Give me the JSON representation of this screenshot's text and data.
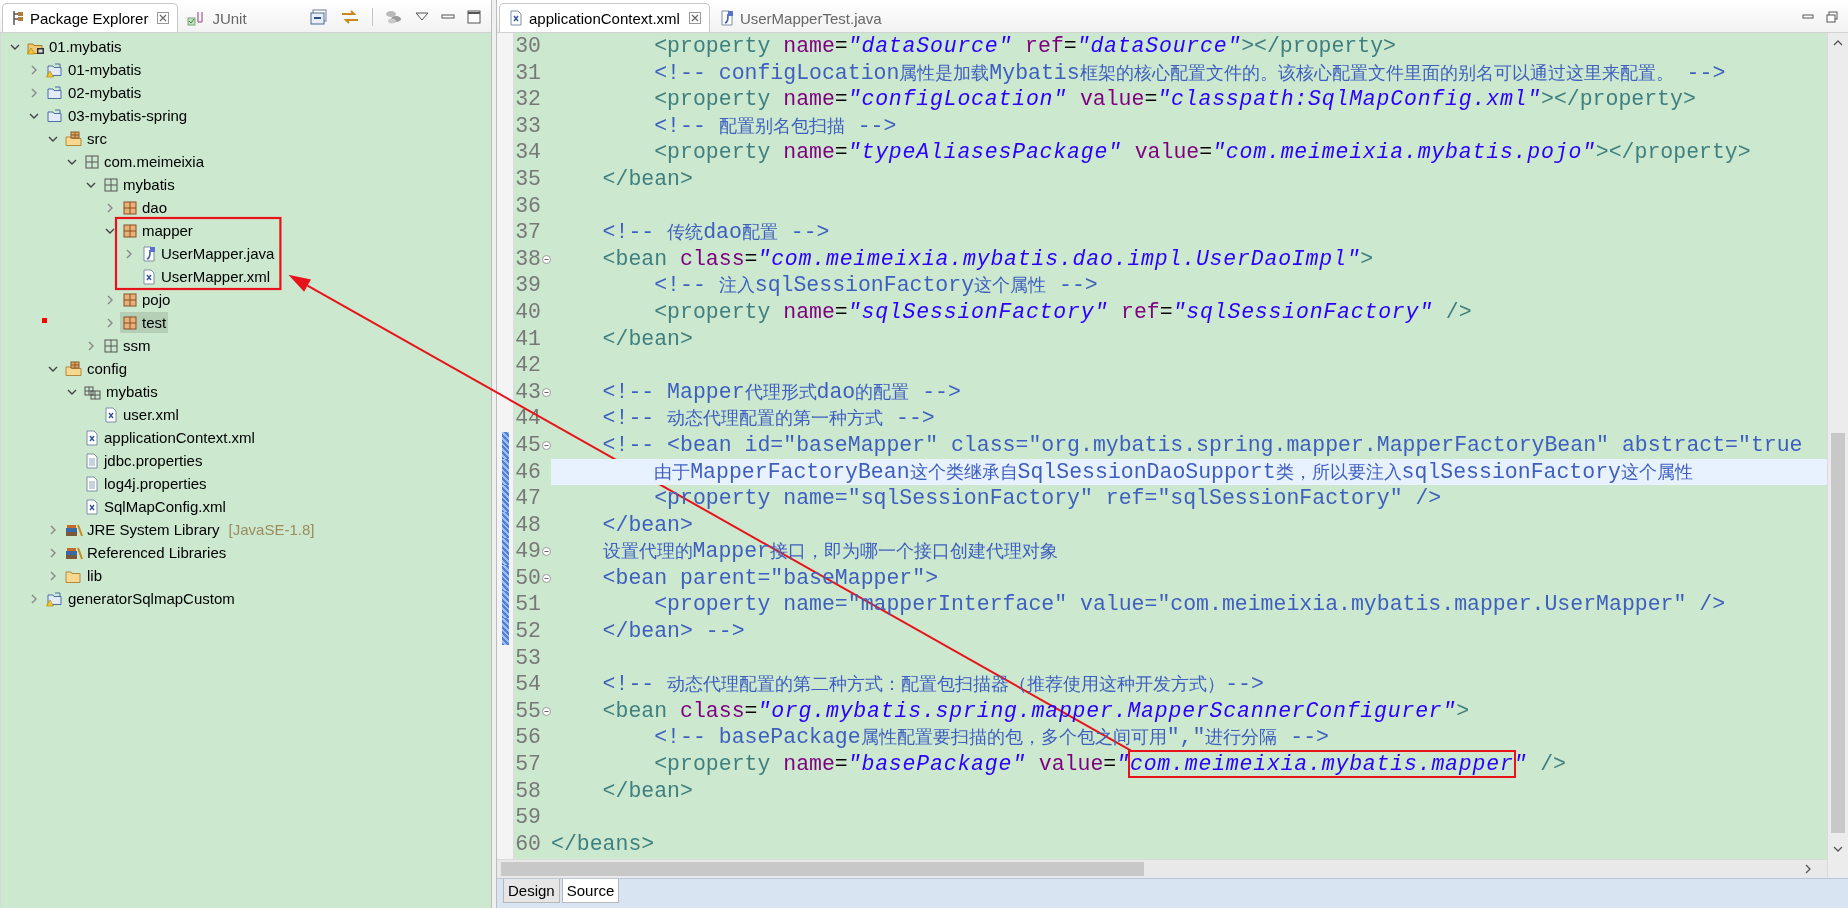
{
  "explorer": {
    "tabs": [
      {
        "label": "Package Explorer",
        "kind": "explorer",
        "selected": true
      },
      {
        "label": "JUnit",
        "kind": "junit",
        "selected": false
      }
    ],
    "tree": [
      {
        "label": "01.mybatis",
        "kind": "working-set",
        "expanded": true,
        "selected": false,
        "boxed": false,
        "children": [
          {
            "label": "01-mybatis",
            "kind": "project-warning",
            "expanded": false,
            "selected": false,
            "boxed": false
          },
          {
            "label": "02-mybatis",
            "kind": "project",
            "expanded": false,
            "selected": false,
            "boxed": false
          },
          {
            "label": "03-mybatis-spring",
            "kind": "project",
            "expanded": true,
            "selected": false,
            "boxed": false,
            "children": [
              {
                "label": "src",
                "kind": "source-folder",
                "expanded": true,
                "selected": false,
                "boxed": false,
                "children": [
                  {
                    "label": "com.meimeixia",
                    "kind": "package-empty",
                    "expanded": true,
                    "selected": false,
                    "boxed": false,
                    "children": [
                      {
                        "label": "mybatis",
                        "kind": "package-empty",
                        "expanded": true,
                        "selected": false,
                        "boxed": false,
                        "children": [
                          {
                            "label": "dao",
                            "kind": "package",
                            "expanded": false,
                            "selected": false,
                            "boxed": false
                          },
                          {
                            "label": "mapper",
                            "kind": "package",
                            "expanded": true,
                            "selected": false,
                            "boxed": true,
                            "children": [
                              {
                                "label": "UserMapper.java",
                                "kind": "java-file",
                                "expanded": false,
                                "selected": false,
                                "boxed": true
                              },
                              {
                                "label": "UserMapper.xml",
                                "kind": "xml-file",
                                "selected": false,
                                "boxed": true
                              }
                            ]
                          },
                          {
                            "label": "pojo",
                            "kind": "package",
                            "expanded": false,
                            "selected": false,
                            "boxed": false
                          },
                          {
                            "label": "test",
                            "kind": "package",
                            "expanded": false,
                            "selected": true,
                            "boxed": false
                          }
                        ]
                      },
                      {
                        "label": "ssm",
                        "kind": "package-empty",
                        "expanded": false,
                        "selected": false,
                        "boxed": false
                      }
                    ]
                  }
                ]
              },
              {
                "label": "config",
                "kind": "source-folder",
                "expanded": true,
                "selected": false,
                "boxed": false,
                "children": [
                  {
                    "label": "mybatis",
                    "kind": "package-hier",
                    "expanded": true,
                    "selected": false,
                    "boxed": false,
                    "children": [
                      {
                        "label": "user.xml",
                        "kind": "xml-file",
                        "selected": false,
                        "boxed": false
                      }
                    ]
                  },
                  {
                    "label": "applicationContext.xml",
                    "kind": "xml-file",
                    "selected": false,
                    "boxed": false
                  },
                  {
                    "label": "jdbc.properties",
                    "kind": "text-file",
                    "selected": false,
                    "boxed": false
                  },
                  {
                    "label": "log4j.properties",
                    "kind": "text-file",
                    "selected": false,
                    "boxed": false
                  },
                  {
                    "label": "SqlMapConfig.xml",
                    "kind": "xml-file",
                    "selected": false,
                    "boxed": false
                  }
                ]
              },
              {
                "label": "JRE System Library",
                "decoration": "[JavaSE-1.8]",
                "kind": "library",
                "expanded": false,
                "selected": false,
                "boxed": false
              },
              {
                "label": "Referenced Libraries",
                "kind": "library",
                "expanded": false,
                "selected": false,
                "boxed": false
              },
              {
                "label": "lib",
                "kind": "folder",
                "expanded": false,
                "selected": false,
                "boxed": false
              }
            ]
          },
          {
            "label": "generatorSqlmapCustom",
            "kind": "project-warning",
            "expanded": false,
            "selected": false,
            "boxed": false
          }
        ]
      }
    ]
  },
  "editor": {
    "tabs": [
      {
        "label": "applicationContext.xml",
        "kind": "xml",
        "selected": true
      },
      {
        "label": "UserMapperTest.java",
        "kind": "java",
        "selected": false
      }
    ],
    "lines": [
      {
        "number": "30",
        "fold": false,
        "changed": false,
        "current": false,
        "segments": [
          {
            "kind": "tag",
            "text": "        <property"
          },
          {
            "kind": "attr",
            "text": " name"
          },
          {
            "kind": "eq",
            "text": "="
          },
          {
            "kind": "value",
            "text": "\"dataSource\""
          },
          {
            "kind": "attr",
            "text": " ref"
          },
          {
            "kind": "eq",
            "text": "="
          },
          {
            "kind": "value",
            "text": "\"dataSource\""
          },
          {
            "kind": "tag",
            "text": "></property>"
          }
        ]
      },
      {
        "number": "31",
        "fold": false,
        "changed": false,
        "current": false,
        "segments": [
          {
            "kind": "comment",
            "text": "        <!-- configLocation属性是加载Mybatis框架的核心配置文件的。该核心配置文件里面的别名可以通过这里来配置。 -->"
          }
        ]
      },
      {
        "number": "32",
        "fold": false,
        "changed": false,
        "current": false,
        "segments": [
          {
            "kind": "tag",
            "text": "        <property"
          },
          {
            "kind": "attr",
            "text": " name"
          },
          {
            "kind": "eq",
            "text": "="
          },
          {
            "kind": "value",
            "text": "\"configLocation\""
          },
          {
            "kind": "attr",
            "text": " value"
          },
          {
            "kind": "eq",
            "text": "="
          },
          {
            "kind": "value",
            "text": "\"classpath:SqlMapConfig.xml\""
          },
          {
            "kind": "tag",
            "text": "></property>"
          }
        ]
      },
      {
        "number": "33",
        "fold": false,
        "changed": false,
        "current": false,
        "segments": [
          {
            "kind": "comment",
            "text": "        <!-- 配置别名包扫描 -->"
          }
        ]
      },
      {
        "number": "34",
        "fold": false,
        "changed": false,
        "current": false,
        "segments": [
          {
            "kind": "tag",
            "text": "        <property"
          },
          {
            "kind": "attr",
            "text": " name"
          },
          {
            "kind": "eq",
            "text": "="
          },
          {
            "kind": "value",
            "text": "\"typeAliasesPackage\""
          },
          {
            "kind": "attr",
            "text": " value"
          },
          {
            "kind": "eq",
            "text": "="
          },
          {
            "kind": "value",
            "text": "\"com.meimeixia.mybatis.pojo\""
          },
          {
            "kind": "tag",
            "text": "></property>"
          }
        ]
      },
      {
        "number": "35",
        "fold": false,
        "changed": false,
        "current": false,
        "segments": [
          {
            "kind": "tag",
            "text": "    </bean>"
          }
        ]
      },
      {
        "number": "36",
        "fold": false,
        "changed": false,
        "current": false
      },
      {
        "number": "37",
        "fold": false,
        "changed": false,
        "current": false,
        "segments": [
          {
            "kind": "comment",
            "text": "    <!-- 传统dao配置 -->"
          }
        ]
      },
      {
        "number": "38",
        "fold": true,
        "changed": false,
        "current": false,
        "segments": [
          {
            "kind": "tag",
            "text": "    <bean"
          },
          {
            "kind": "attr",
            "text": " class"
          },
          {
            "kind": "eq",
            "text": "="
          },
          {
            "kind": "value",
            "text": "\"com.meimeixia.mybatis.dao.impl.UserDaoImpl\""
          },
          {
            "kind": "tag",
            "text": ">"
          }
        ]
      },
      {
        "number": "39",
        "fold": false,
        "changed": false,
        "current": false,
        "segments": [
          {
            "kind": "comment",
            "text": "        <!-- 注入sqlSessionFactory这个属性 -->"
          }
        ]
      },
      {
        "number": "40",
        "fold": false,
        "changed": false,
        "current": false,
        "segments": [
          {
            "kind": "tag",
            "text": "        <property"
          },
          {
            "kind": "attr",
            "text": " name"
          },
          {
            "kind": "eq",
            "text": "="
          },
          {
            "kind": "value",
            "text": "\"sqlSessionFactory\""
          },
          {
            "kind": "attr",
            "text": " ref"
          },
          {
            "kind": "eq",
            "text": "="
          },
          {
            "kind": "value",
            "text": "\"sqlSessionFactory\""
          },
          {
            "kind": "tag",
            "text": " />"
          }
        ]
      },
      {
        "number": "41",
        "fold": false,
        "changed": false,
        "current": false,
        "segments": [
          {
            "kind": "tag",
            "text": "    </bean>"
          }
        ]
      },
      {
        "number": "42",
        "fold": false,
        "changed": false,
        "current": false
      },
      {
        "number": "43",
        "fold": true,
        "changed": false,
        "current": false,
        "segments": [
          {
            "kind": "comment",
            "text": "    <!-- Mapper代理形式dao的配置 -->"
          }
        ]
      },
      {
        "number": "44",
        "fold": false,
        "changed": false,
        "current": false,
        "segments": [
          {
            "kind": "comment",
            "text": "    <!-- 动态代理配置的第一种方式 -->"
          }
        ]
      },
      {
        "number": "45",
        "fold": true,
        "changed": true,
        "current": false,
        "segments": [
          {
            "kind": "comment",
            "text": "    <!-- <bean id=\"baseMapper\" class=\"org.mybatis.spring.mapper.MapperFactoryBean\" abstract=\"true"
          }
        ]
      },
      {
        "number": "46",
        "fold": false,
        "changed": true,
        "current": true,
        "segments": [
          {
            "kind": "comment",
            "text": "        由于MapperFactoryBean这个类继承自SqlSessionDaoSupport类，所以要注入sqlSessionFactory这个属性"
          }
        ]
      },
      {
        "number": "47",
        "fold": false,
        "changed": true,
        "current": false,
        "segments": [
          {
            "kind": "comment",
            "text": "        <property name=\"sqlSessionFactory\" ref=\"sqlSessionFactory\" />"
          }
        ]
      },
      {
        "number": "48",
        "fold": false,
        "changed": true,
        "current": false,
        "segments": [
          {
            "kind": "comment",
            "text": "    </bean>"
          }
        ]
      },
      {
        "number": "49",
        "fold": true,
        "changed": true,
        "current": false,
        "segments": [
          {
            "kind": "comment",
            "text": "    设置代理的Mapper接口，即为哪一个接口创建代理对象"
          }
        ]
      },
      {
        "number": "50",
        "fold": true,
        "changed": true,
        "current": false,
        "segments": [
          {
            "kind": "comment",
            "text": "    <bean parent=\"baseMapper\">"
          }
        ]
      },
      {
        "number": "51",
        "fold": false,
        "changed": true,
        "current": false,
        "segments": [
          {
            "kind": "comment",
            "text": "        <property name=\"mapperInterface\" value=\"com.meimeixia.mybatis.mapper.UserMapper\" />"
          }
        ]
      },
      {
        "number": "52",
        "fold": false,
        "changed": true,
        "current": false,
        "segments": [
          {
            "kind": "comment",
            "text": "    </bean> -->"
          }
        ]
      },
      {
        "number": "53",
        "fold": false,
        "changed": false,
        "current": false
      },
      {
        "number": "54",
        "fold": false,
        "changed": false,
        "current": false,
        "segments": [
          {
            "kind": "comment",
            "text": "    <!-- 动态代理配置的第二种方式：配置包扫描器（推荐使用这种开发方式）-->"
          }
        ]
      },
      {
        "number": "55",
        "fold": true,
        "changed": false,
        "current": false,
        "segments": [
          {
            "kind": "tag",
            "text": "    <bean"
          },
          {
            "kind": "attr",
            "text": " class"
          },
          {
            "kind": "eq",
            "text": "="
          },
          {
            "kind": "value",
            "text": "\"org.mybatis.spring.mapper.MapperScannerConfigurer\""
          },
          {
            "kind": "tag",
            "text": ">"
          }
        ]
      },
      {
        "number": "56",
        "fold": false,
        "changed": false,
        "current": false,
        "segments": [
          {
            "kind": "comment",
            "text": "        <!-- basePackage属性配置要扫描的包，多个包之间可用\",\"进行分隔 -->"
          }
        ]
      },
      {
        "number": "57",
        "fold": false,
        "changed": false,
        "current": false,
        "segments": [
          {
            "kind": "tag",
            "text": "        <property"
          },
          {
            "kind": "attr",
            "text": " name"
          },
          {
            "kind": "eq",
            "text": "="
          },
          {
            "kind": "value",
            "text": "\"basePackage\""
          },
          {
            "kind": "attr",
            "text": " value"
          },
          {
            "kind": "eq",
            "text": "="
          },
          {
            "kind": "value",
            "text": "\""
          },
          {
            "kind": "boxed-value",
            "text": "com.meimeixia.mybatis.mapper"
          },
          {
            "kind": "value",
            "text": "\""
          },
          {
            "kind": "tag",
            "text": " />"
          }
        ]
      },
      {
        "number": "58",
        "fold": false,
        "changed": false,
        "current": false,
        "segments": [
          {
            "kind": "tag",
            "text": "    </bean>"
          }
        ]
      },
      {
        "number": "59",
        "fold": false,
        "changed": false,
        "current": false
      },
      {
        "number": "60",
        "fold": false,
        "changed": false,
        "current": false,
        "segments": [
          {
            "kind": "tag",
            "text": "</beans>"
          }
        ]
      }
    ],
    "bottom_tabs": [
      {
        "label": "Design",
        "selected": false
      },
      {
        "label": "Source",
        "selected": true
      }
    ]
  }
}
